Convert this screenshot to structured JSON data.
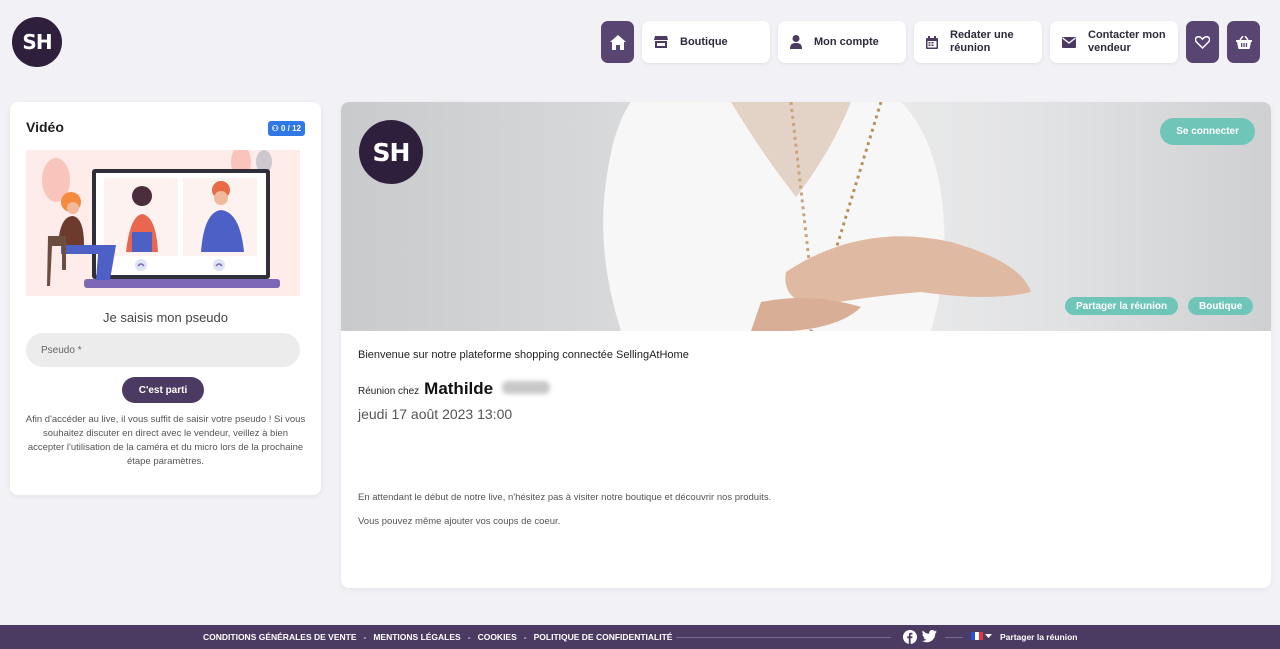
{
  "header": {
    "logo_text": "SH",
    "nav": {
      "home_icon": "home-icon",
      "shop_label": "Boutique",
      "account_label": "Mon compte",
      "plan_label": "Redater une réunion",
      "contact_label": "Contacter mon vendeur",
      "favorites_icon": "heart-icon",
      "cart_icon": "basket-icon"
    }
  },
  "video": {
    "title": "Vidéo",
    "counter": "0 / 12",
    "pseudo_heading": "Je saisis mon pseudo",
    "pseudo_placeholder": "Pseudo *",
    "go_label": "C'est parti",
    "help_text": "Afin d'accéder au live, il vous suffit de saisir votre pseudo ! Si vous souhaitez discuter en direct avec le vendeur, veillez à bien accepter l'utilisation de la caméra et du micro lors de la prochaine étape paramètres."
  },
  "main": {
    "banner_logo": "SH",
    "connect_label": "Se connecter",
    "share_label": "Partager la réunion",
    "shop_label": "Boutique",
    "welcome": "Bienvenue sur notre plateforme shopping connectée SellingAtHome",
    "reunion_prefix": "Réunion chez",
    "host_name": "Mathilde",
    "date": "jeudi 17 août 2023 13:00",
    "wait_text": "En attendant le début de notre live, n'hésitez pas à visiter notre boutique et découvrir nos produits.",
    "fav_text": "Vous pouvez même ajouter vos coups de coeur."
  },
  "footer": {
    "links": [
      "CONDITIONS GÉNÉRALES DE VENTE",
      "MENTIONS LÉGALES",
      "COOKIES",
      "POLITIQUE DE CONFIDENTIALITÉ"
    ],
    "separator": "-",
    "share_label": "Partager la réunion",
    "colors": {
      "footer_bg": "#4b3a62",
      "accent": "#6fc6b8",
      "brand": "#584571"
    }
  }
}
